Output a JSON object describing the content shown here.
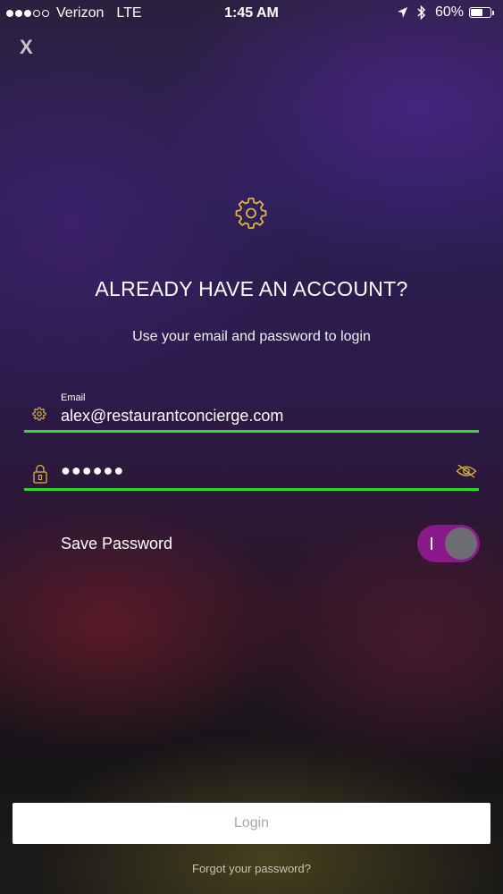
{
  "status_bar": {
    "carrier": "Verizon",
    "network": "LTE",
    "time": "1:45 AM",
    "battery_percent": "60%",
    "battery_level": 0.6,
    "signal_bars_filled": 3,
    "signal_bars_total": 5,
    "icons": [
      "location-arrow-icon",
      "bluetooth-icon",
      "battery-icon"
    ]
  },
  "close_label": "X",
  "logo_icon": "gear-icon",
  "title": "ALREADY HAVE AN ACCOUNT?",
  "subtitle": "Use your email and password to login",
  "email_field": {
    "label": "Email",
    "value": "alex@restaurantconcierge.com",
    "icon": "gear-icon"
  },
  "password_field": {
    "masked_value": "●●●●●●",
    "icon": "lock-icon",
    "toggle_icon": "eye-slash-icon"
  },
  "save_password": {
    "label": "Save Password",
    "toggle_symbol": "I",
    "enabled": true
  },
  "login_button": "Login",
  "forgot_password_link": "Forgot your password?",
  "colors": {
    "accent_gold": "#e0b43a",
    "underline_green": "#2edb2e",
    "toggle_purple": "#8a1a8c",
    "button_text_gray": "#a8a8ac"
  }
}
